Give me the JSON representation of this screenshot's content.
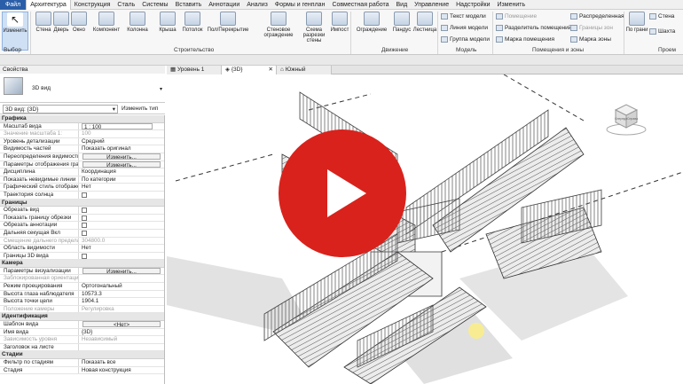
{
  "menu": {
    "file": "Файл",
    "items": [
      "Архитектура",
      "Конструкция",
      "Сталь",
      "Системы",
      "Вставить",
      "Аннотации",
      "Анализ",
      "Формы и генплан",
      "Совместная работа",
      "Вид",
      "Управление",
      "Надстройки",
      "Изменить"
    ]
  },
  "ribbon": {
    "select": {
      "modify": "Изменить",
      "group": "Выбор"
    },
    "build": {
      "wall": "Стена",
      "door": "Дверь",
      "window": "Окно",
      "component": "Компонент",
      "column": "Колонна",
      "roof": "Крыша",
      "ceiling": "Потолок",
      "floor": "Пол/Перекрытие",
      "curtain_wall": "Стеновое ограждение",
      "curtain_grid": "Схема разрезки стены",
      "mullion": "Импост",
      "group": "Строительство"
    },
    "circulation": {
      "railing": "Ограждение",
      "ramp": "Пандус",
      "stair": "Лестница",
      "group": "Движение"
    },
    "model": {
      "text": "Текст модели",
      "line": "Линия модели",
      "group_btn": "Группа модели",
      "group": "Модель"
    },
    "room": {
      "room": "Помещение",
      "separator": "Разделитель помещений",
      "tag": "Марка помещения",
      "area": "Распределенная",
      "area_boundary": "Границы зон",
      "area_tag": "Марка зоны",
      "group": "Помещения и зоны"
    },
    "opening": {
      "by_face": "По грани",
      "shaft": "Шахта",
      "wall": "Стена",
      "group": "Проем"
    }
  },
  "properties": {
    "title": "Свойства",
    "type_name": "3D вид",
    "selector": "3D вид: {3D}",
    "edit_type": "Изменить тип",
    "sections": [
      {
        "name": "Графика",
        "rows": [
          {
            "k": "Масштаб вида",
            "v": "1 : 100",
            "t": "box"
          },
          {
            "k": "Значение масштаба    1:",
            "v": "100",
            "t": "dis"
          },
          {
            "k": "Уровень детализации",
            "v": "Средний"
          },
          {
            "k": "Видимость частей",
            "v": "Показать оригинал"
          },
          {
            "k": "Переопределения видимости...",
            "v": "Изменить...",
            "t": "btn"
          },
          {
            "k": "Параметры отображения граф...",
            "v": "Изменить...",
            "t": "btn"
          },
          {
            "k": "Дисциплина",
            "v": "Координация"
          },
          {
            "k": "Показать невидимые линии",
            "v": "По категории"
          },
          {
            "k": "Графический стиль отображе...",
            "v": "Нет"
          },
          {
            "k": "Траектория солнца",
            "v": "",
            "t": "cb"
          }
        ]
      },
      {
        "name": "Границы",
        "rows": [
          {
            "k": "Обрезать вид",
            "v": "",
            "t": "cb"
          },
          {
            "k": "Показать границу обрезки",
            "v": "",
            "t": "cb"
          },
          {
            "k": "Обрезать аннотации",
            "v": "",
            "t": "cb"
          },
          {
            "k": "Дальняя секущая Вкл",
            "v": "",
            "t": "cb"
          },
          {
            "k": "Смещение дальнего предела ...",
            "v": "304800.0",
            "t": "dis"
          },
          {
            "k": "Область видимости",
            "v": "Нет"
          },
          {
            "k": "Границы 3D вида",
            "v": "",
            "t": "cb"
          }
        ]
      },
      {
        "name": "Камера",
        "rows": [
          {
            "k": "Параметры визуализации",
            "v": "Изменить...",
            "t": "btn"
          },
          {
            "k": "Заблокированная ориентация",
            "v": "",
            "t": "dis"
          },
          {
            "k": "Режим проецирования",
            "v": "Ортогональный"
          },
          {
            "k": "Высота глаза наблюдателя",
            "v": "10573.3"
          },
          {
            "k": "Высота точки цели",
            "v": "1904.1"
          },
          {
            "k": "Положение камеры",
            "v": "Регулировка",
            "t": "dis"
          }
        ]
      },
      {
        "name": "Идентификация",
        "rows": [
          {
            "k": "Шаблон вида",
            "v": "<Нет>",
            "t": "btn"
          },
          {
            "k": "Имя вида",
            "v": "{3D}"
          },
          {
            "k": "Зависимость уровня",
            "v": "Независимый",
            "t": "dis"
          },
          {
            "k": "Заголовок на листе",
            "v": ""
          }
        ]
      },
      {
        "name": "Стадии",
        "rows": [
          {
            "k": "Фильтр по стадиям",
            "v": "Показать все"
          },
          {
            "k": "Стадия",
            "v": "Новая конструкция"
          }
        ]
      }
    ]
  },
  "view_tabs": [
    "Уровень 1",
    "{3D}",
    "Южный"
  ],
  "viewcube": {
    "front": "Спереди",
    "right": "Справа"
  }
}
